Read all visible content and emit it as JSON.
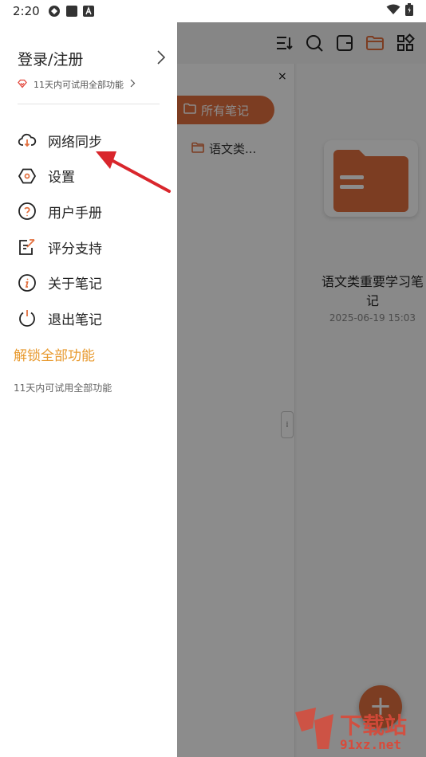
{
  "status_bar": {
    "time": "2:20",
    "icons": [
      "app-icon",
      "square-icon",
      "a-icon"
    ],
    "right_icons": [
      "wifi-icon",
      "battery-icon"
    ]
  },
  "background_app": {
    "toolbar_icons": [
      "sort-icon",
      "search-icon",
      "card-icon",
      "folder-icon",
      "grid-icon"
    ],
    "folder_panel": {
      "close": "×",
      "all_notes": "所有笔记",
      "folders": [
        "语文类..."
      ]
    },
    "note": {
      "title": "语文类重要学习笔记",
      "date": "2025-06-19 15:03"
    },
    "fab": "+"
  },
  "drawer": {
    "login_title": "登录/注册",
    "trial_text": "11天内可试用全部功能",
    "menu": [
      {
        "label": "网络同步",
        "icon": "cloud-sync-icon"
      },
      {
        "label": "设置",
        "icon": "hexagon-settings-icon"
      },
      {
        "label": "用户手册",
        "icon": "question-icon"
      },
      {
        "label": "评分支持",
        "icon": "rate-edit-icon"
      },
      {
        "label": "关于笔记",
        "icon": "info-icon"
      },
      {
        "label": "退出笔记",
        "icon": "power-icon"
      }
    ],
    "unlock_title": "解锁全部功能",
    "unlock_trial": "11天内可试用全部功能"
  },
  "watermark": {
    "brand": "下载站",
    "site": "91xz.net"
  },
  "colors": {
    "accent": "#e2703f",
    "unlock": "#e89a2f",
    "arrow": "#d9262c"
  }
}
